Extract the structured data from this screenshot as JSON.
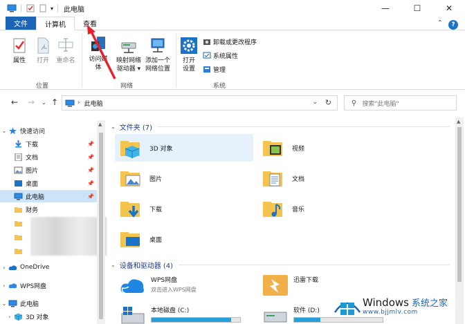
{
  "title_bar": {
    "title": "此电脑"
  },
  "ribbon_tabs": [
    {
      "label": "文件"
    },
    {
      "label": "计算机"
    },
    {
      "label": "查看"
    }
  ],
  "ribbon": {
    "properties": "属性",
    "open": "打开",
    "rename": "重命名",
    "access_media_1": "访问媒",
    "access_media_2": "体",
    "map_drive_1": "映射网络",
    "map_drive_2": "驱动器",
    "add_location_1": "添加一个",
    "add_location_2": "网络位置",
    "open_settings_1": "打开",
    "open_settings_2": "设置",
    "uninstall": "卸载或更改程序",
    "system_props": "系统属性",
    "manage": "管理",
    "group_location": "位置",
    "group_network": "网络",
    "group_system": "系统"
  },
  "address": {
    "path": "此电脑",
    "search_placeholder": "搜索\"此电脑\""
  },
  "nav_pane": [
    {
      "label": "快速访问",
      "icon": "star-icon",
      "expanded": true
    },
    {
      "label": "下载",
      "icon": "download-icon",
      "pinned": true
    },
    {
      "label": "文档",
      "icon": "document-icon",
      "pinned": true
    },
    {
      "label": "图片",
      "icon": "picture-icon",
      "pinned": true
    },
    {
      "label": "桌面",
      "icon": "desktop-icon",
      "pinned": true
    },
    {
      "label": "此电脑",
      "icon": "pc-icon",
      "pinned": true,
      "selected": true
    },
    {
      "label": "财务",
      "icon": "folder-icon"
    },
    {
      "label": "OneDrive",
      "icon": "cloud-icon"
    },
    {
      "label": "WPS网盘",
      "icon": "wps-cloud-icon"
    },
    {
      "label": "此电脑",
      "icon": "pc-icon",
      "expanded": true
    },
    {
      "label": "3D 对象",
      "icon": "3d-objects-icon"
    }
  ],
  "sections": {
    "folders": "文件夹 (7)",
    "devices": "设备和驱动器 (4)"
  },
  "folders": [
    {
      "label": "3D 对象",
      "icon": "3d-objects-icon"
    },
    {
      "label": "视频",
      "icon": "video-icon"
    },
    {
      "label": "图片",
      "icon": "picture-icon"
    },
    {
      "label": "文档",
      "icon": "document-icon"
    },
    {
      "label": "下载",
      "icon": "download-icon"
    },
    {
      "label": "音乐",
      "icon": "music-icon"
    },
    {
      "label": "桌面",
      "icon": "desktop-icon"
    }
  ],
  "drives": [
    {
      "label": "WPS网盘",
      "sub": "双击进入WPS网盘",
      "icon": "wps-cloud-icon"
    },
    {
      "label": "迅雷下载",
      "icon": "thunder-icon"
    },
    {
      "label": "本地磁盘 (C:)",
      "icon": "windows-drive-icon",
      "used": 0.9
    },
    {
      "label": "软件 (D:)",
      "icon": "drive-icon",
      "used": 0.3
    }
  ],
  "watermark": {
    "brand": "Windows",
    "cn": "系统之家",
    "url": "www.bjjmlv.com"
  },
  "colors": {
    "accent": "#1a65b5",
    "selection": "#cce4f7",
    "folder_yellow": "#f4c44e",
    "arrow_red": "#e8202a"
  }
}
